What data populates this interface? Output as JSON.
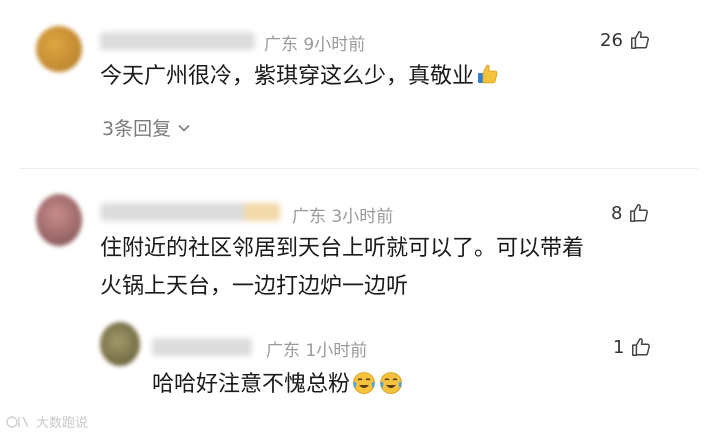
{
  "comments": [
    {
      "location": "广东",
      "time": "9小时前",
      "likes": "26",
      "text": "今天广州很冷，紫琪穿这么少，真敬业",
      "emoji_icon": "thumbs-up-emoji-icon",
      "replies_label": "3条回复"
    },
    {
      "location": "广东",
      "time": "3小时前",
      "likes": "8",
      "text_line1": "住附近的社区邻居到天台上听就可以了。可以带着",
      "text_line2": "火锅上天台，一边打边炉一边听"
    },
    {
      "location": "广东",
      "time": "1小时前",
      "likes": "1",
      "text": "哈哈好注意不愧总粉",
      "emoji_icon": "crying-laughing-emoji-icon"
    }
  ],
  "watermark": "大数跑说",
  "icons": {
    "like": "thumbs-up-outline-icon",
    "chevron": "chevron-down-icon"
  },
  "colors": {
    "meta": "#9a9a9a",
    "text": "#1a1a1a",
    "emoji_yellow": "#f5c33b"
  }
}
